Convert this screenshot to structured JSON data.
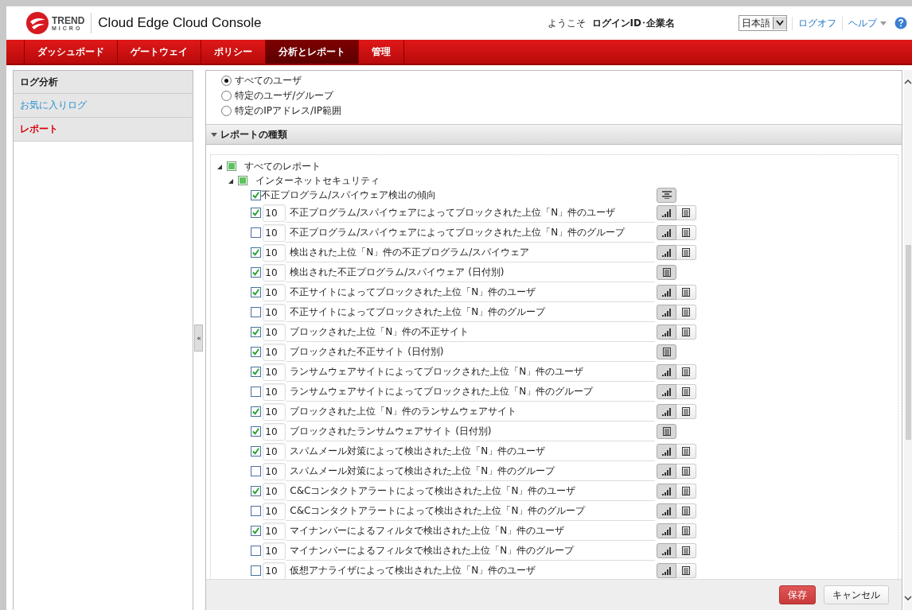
{
  "header": {
    "logo_top": "TREND",
    "logo_bottom": "MICRO",
    "title": "Cloud Edge Cloud Console",
    "welcome": "ようこそ",
    "user": "ログインID･企業名",
    "language": "日本語",
    "logoff": "ログオフ",
    "help": "ヘルプ"
  },
  "nav": [
    {
      "label": "ダッシュボード",
      "selected": false
    },
    {
      "label": "ゲートウェイ",
      "selected": false
    },
    {
      "label": "ポリシー",
      "selected": false
    },
    {
      "label": "分析とレポート",
      "selected": true
    },
    {
      "label": "管理",
      "selected": false
    }
  ],
  "sidebar": {
    "heading": "ログ分析",
    "items": [
      {
        "label": "お気に入りログ",
        "selected": false
      },
      {
        "label": "レポート",
        "selected": true
      }
    ],
    "collapse": "«"
  },
  "scope": [
    {
      "label": "すべてのユーザ",
      "selected": true
    },
    {
      "label": "特定のユーザ/グループ",
      "selected": false
    },
    {
      "label": "特定のIPアドレス/IP範囲",
      "selected": false
    }
  ],
  "section": {
    "title": "レポートの種類",
    "expanded": true
  },
  "tree": {
    "label": "すべてのレポート",
    "indeterminate": true,
    "children": [
      {
        "label": "インターネットセキュリティ",
        "indeterminate": true,
        "trend": {
          "label": "不正プログラム/スパイウェア検出の傾向",
          "checked": true
        },
        "reports": [
          {
            "checked": true,
            "count": "10",
            "label": "不正プログラム/スパイウェアによってブロックされた上位「N」件のユーザ",
            "kind": "chart_table"
          },
          {
            "checked": false,
            "count": "10",
            "label": "不正プログラム/スパイウェアによってブロックされた上位「N」件のグループ",
            "kind": "chart_table"
          },
          {
            "checked": true,
            "count": "10",
            "label": "検出された上位「N」件の不正プログラム/スパイウェア",
            "kind": "chart_table"
          },
          {
            "checked": true,
            "count": "10",
            "label": "検出された不正プログラム/スパイウェア (日付別)",
            "kind": "table"
          },
          {
            "checked": true,
            "count": "10",
            "label": "不正サイトによってブロックされた上位「N」件のユーザ",
            "kind": "chart_table"
          },
          {
            "checked": false,
            "count": "10",
            "label": "不正サイトによってブロックされた上位「N」件のグループ",
            "kind": "chart_table"
          },
          {
            "checked": true,
            "count": "10",
            "label": "ブロックされた上位「N」件の不正サイト",
            "kind": "chart_table"
          },
          {
            "checked": true,
            "count": "10",
            "label": "ブロックされた不正サイト (日付別)",
            "kind": "table"
          },
          {
            "checked": true,
            "count": "10",
            "label": "ランサムウェアサイトによってブロックされた上位「N」件のユーザ",
            "kind": "chart_table"
          },
          {
            "checked": false,
            "count": "10",
            "label": "ランサムウェアサイトによってブロックされた上位「N」件のグループ",
            "kind": "chart_table"
          },
          {
            "checked": true,
            "count": "10",
            "label": "ブロックされた上位「N」件のランサムウェアサイト",
            "kind": "chart_table"
          },
          {
            "checked": true,
            "count": "10",
            "label": "ブロックされたランサムウェアサイト (日付別)",
            "kind": "table"
          },
          {
            "checked": true,
            "count": "10",
            "label": "スパムメール対策によって検出された上位「N」件のユーザ",
            "kind": "chart_table"
          },
          {
            "checked": false,
            "count": "10",
            "label": "スパムメール対策によって検出された上位「N」件のグループ",
            "kind": "chart_table"
          },
          {
            "checked": true,
            "count": "10",
            "label": "C&Cコンタクトアラートによって検出された上位「N」件のユーザ",
            "kind": "chart_table"
          },
          {
            "checked": false,
            "count": "10",
            "label": "C&Cコンタクトアラートによって検出された上位「N」件のグループ",
            "kind": "chart_table"
          },
          {
            "checked": true,
            "count": "10",
            "label": "マイナンバーによるフィルタで検出された上位「N」件のユーザ",
            "kind": "chart_table"
          },
          {
            "checked": false,
            "count": "10",
            "label": "マイナンバーによるフィルタで検出された上位「N」件のグループ",
            "kind": "chart_table"
          },
          {
            "checked": false,
            "count": "10",
            "label": "仮想アナライザによって検出された上位「N」件のユーザ",
            "kind": "chart_table"
          }
        ]
      }
    ]
  },
  "footer": {
    "save": "保存",
    "cancel": "キャンセル"
  }
}
